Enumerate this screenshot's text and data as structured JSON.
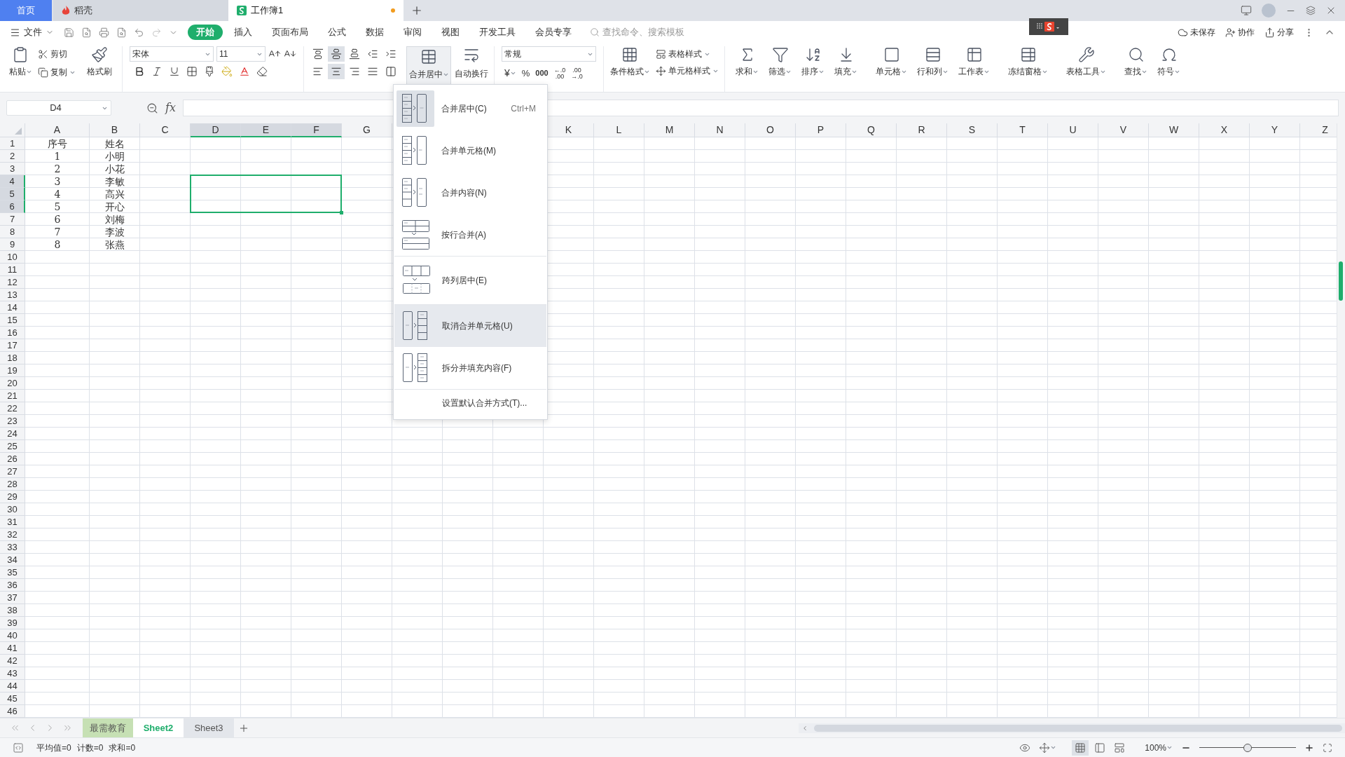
{
  "tabs": [
    {
      "kind": "home",
      "label": "首页",
      "selected": false,
      "modified": false
    },
    {
      "kind": "docer",
      "label": "稻壳",
      "selected": false,
      "modified": false
    },
    {
      "kind": "sheet",
      "label": "工作簿1",
      "selected": true,
      "modified": true
    }
  ],
  "menu": {
    "file": "文件",
    "items": [
      {
        "label": "开始",
        "selected": true
      },
      {
        "label": "插入",
        "selected": false
      },
      {
        "label": "页面布局",
        "selected": false
      },
      {
        "label": "公式",
        "selected": false
      },
      {
        "label": "数据",
        "selected": false
      },
      {
        "label": "审阅",
        "selected": false
      },
      {
        "label": "视图",
        "selected": false
      },
      {
        "label": "开发工具",
        "selected": false
      },
      {
        "label": "会员专享",
        "selected": false
      }
    ],
    "search_placeholder": "查找命令、搜索模板",
    "actions": [
      {
        "kind": "cloud",
        "label": "未保存"
      },
      {
        "kind": "collab",
        "label": "协作"
      },
      {
        "kind": "share",
        "label": "分享"
      }
    ]
  },
  "ribbon": {
    "clipboard": {
      "paste": "粘贴",
      "cut": "剪切",
      "copy": "复制",
      "format_painter": "格式刷"
    },
    "font": {
      "name": "宋体",
      "size": "11"
    },
    "align_buttons": [
      {
        "kind": "top",
        "selected": false
      },
      {
        "kind": "middle",
        "selected": true
      },
      {
        "kind": "bottom",
        "selected": false
      },
      {
        "kind": "indent_less",
        "selected": false
      },
      {
        "kind": "indent_more",
        "selected": false
      },
      {
        "kind": "left",
        "selected": false
      },
      {
        "kind": "center",
        "selected": true
      },
      {
        "kind": "right",
        "selected": false
      },
      {
        "kind": "justify",
        "selected": false
      },
      {
        "kind": "distributed",
        "selected": false
      }
    ],
    "merge": {
      "label": "合并居中",
      "expanded": true
    },
    "wrap": "自动换行",
    "number": {
      "format": "常规",
      "currency": "¥",
      "percent": "%",
      "thousands": "000",
      "increase_decimal": [
        "←.0",
        ".00"
      ],
      "decrease_decimal": [
        ".00",
        "→.0"
      ]
    },
    "styles": {
      "conditional": "条件格式",
      "table_style": "表格样式",
      "cell_style": "单元格样式"
    },
    "tools": [
      {
        "kind": "sum",
        "label": "求和"
      },
      {
        "kind": "filter",
        "label": "筛选"
      },
      {
        "kind": "sort",
        "label": "排序"
      },
      {
        "kind": "fill",
        "label": "填充"
      },
      {
        "kind": "cell",
        "label": "单元格"
      },
      {
        "kind": "rowcol",
        "label": "行和列"
      },
      {
        "kind": "worksheet",
        "label": "工作表"
      },
      {
        "kind": "freeze",
        "label": "冻结窗格"
      },
      {
        "kind": "tabletools",
        "label": "表格工具"
      },
      {
        "kind": "find",
        "label": "查找"
      },
      {
        "kind": "symbol",
        "label": "符号"
      }
    ]
  },
  "formula_bar": {
    "name_box": "D4",
    "fx": "fx"
  },
  "columns": [
    {
      "label": "A",
      "selected": false
    },
    {
      "label": "B",
      "selected": false
    },
    {
      "label": "C",
      "selected": false
    },
    {
      "label": "D",
      "selected": true
    },
    {
      "label": "E",
      "selected": true
    },
    {
      "label": "F",
      "selected": true
    },
    {
      "label": "G",
      "selected": false
    },
    {},
    {},
    {},
    {
      "label": "K",
      "selected": false
    },
    {
      "label": "L",
      "selected": false
    },
    {
      "label": "M",
      "selected": false
    },
    {
      "label": "N",
      "selected": false
    },
    {
      "label": "O",
      "selected": false
    },
    {
      "label": "P",
      "selected": false
    },
    {
      "label": "Q",
      "selected": false
    },
    {
      "label": "R",
      "selected": false
    },
    {
      "label": "S",
      "selected": false
    },
    {
      "label": "T",
      "selected": false
    },
    {
      "label": "U",
      "selected": false
    },
    {
      "label": "V",
      "selected": false
    },
    {
      "label": "W",
      "selected": false
    },
    {
      "label": "X",
      "selected": false
    },
    {
      "label": "Y",
      "selected": false
    },
    {
      "label": "Z",
      "selected": false
    }
  ],
  "rows": [
    {
      "label": "1",
      "selected": false,
      "cells": [
        "序号",
        "姓名"
      ]
    },
    {
      "label": "2",
      "selected": false,
      "cells": [
        "1",
        "小明"
      ]
    },
    {
      "label": "3",
      "selected": false,
      "cells": [
        "2",
        "小花"
      ]
    },
    {
      "label": "4",
      "selected": true,
      "cells": [
        "3",
        "李敏"
      ]
    },
    {
      "label": "5",
      "selected": true,
      "cells": [
        "4",
        "高兴"
      ]
    },
    {
      "label": "6",
      "selected": true,
      "cells": [
        "5",
        "开心"
      ]
    },
    {
      "label": "7",
      "selected": false,
      "cells": [
        "6",
        "刘梅"
      ]
    },
    {
      "label": "8",
      "selected": false,
      "cells": [
        "7",
        "李波"
      ]
    },
    {
      "label": "9",
      "selected": false,
      "cells": [
        "8",
        "张燕"
      ]
    },
    {
      "label": "10",
      "selected": false
    },
    {
      "label": "11",
      "selected": false
    },
    {
      "label": "12",
      "selected": false
    },
    {
      "label": "13",
      "selected": false
    },
    {
      "label": "14",
      "selected": false
    },
    {
      "label": "15",
      "selected": false
    },
    {
      "label": "16",
      "selected": false
    },
    {
      "label": "17",
      "selected": false
    },
    {
      "label": "18",
      "selected": false
    },
    {
      "label": "19",
      "selected": false
    },
    {
      "label": "20",
      "selected": false
    },
    {
      "label": "21",
      "selected": false
    },
    {
      "label": "22",
      "selected": false
    },
    {
      "label": "23",
      "selected": false
    },
    {
      "label": "24",
      "selected": false
    },
    {
      "label": "25",
      "selected": false
    },
    {
      "label": "26",
      "selected": false
    },
    {
      "label": "27",
      "selected": false
    },
    {
      "label": "28",
      "selected": false
    },
    {
      "label": "29",
      "selected": false
    },
    {
      "label": "30",
      "selected": false
    },
    {
      "label": "31",
      "selected": false
    },
    {
      "label": "32",
      "selected": false
    },
    {
      "label": "33",
      "selected": false
    },
    {
      "label": "34",
      "selected": false
    },
    {
      "label": "35",
      "selected": false
    },
    {
      "label": "36",
      "selected": false
    },
    {
      "label": "37",
      "selected": false
    },
    {
      "label": "38",
      "selected": false
    },
    {
      "label": "39",
      "selected": false
    },
    {
      "label": "40",
      "selected": false
    },
    {
      "label": "41",
      "selected": false
    },
    {
      "label": "42",
      "selected": false
    },
    {
      "label": "43",
      "selected": false
    },
    {
      "label": "44",
      "selected": false
    },
    {
      "label": "45",
      "selected": false
    },
    {
      "label": "46",
      "selected": false
    }
  ],
  "merge_menu": {
    "groups": [
      [
        {
          "kind": "merge_center",
          "label": "合并居中(C)",
          "shortcut": "Ctrl+M",
          "current": true,
          "highlighted": false
        },
        {
          "kind": "merge_cells",
          "label": "合并单元格(M)",
          "current": false,
          "highlighted": false
        },
        {
          "kind": "merge_content",
          "label": "合并内容(N)",
          "current": false,
          "highlighted": false
        },
        {
          "kind": "merge_rows",
          "label": "按行合并(A)",
          "current": false,
          "highlighted": false
        }
      ],
      [
        {
          "kind": "center_across",
          "label": "跨列居中(E)",
          "current": false,
          "highlighted": false
        }
      ],
      [
        {
          "kind": "unmerge",
          "label": "取消合并单元格(U)",
          "current": false,
          "highlighted": true
        },
        {
          "kind": "split_fill",
          "label": "拆分并填充内容(F)",
          "current": false,
          "highlighted": false
        }
      ],
      [
        {
          "kind": "setting",
          "label": "设置默认合并方式(T)...",
          "current": false,
          "highlighted": false
        }
      ]
    ]
  },
  "sheet_tabs": [
    {
      "label": "最需教育",
      "selected": false,
      "color": "#c6e0b4"
    },
    {
      "label": "Sheet2",
      "selected": true
    },
    {
      "label": "Sheet3",
      "selected": false
    }
  ],
  "status_bar": {
    "stats": [
      "平均值=0",
      "计数=0",
      "求和=0"
    ],
    "views": [
      {
        "kind": "normal",
        "selected": true
      },
      {
        "kind": "page",
        "selected": false
      },
      {
        "kind": "break",
        "selected": false
      }
    ],
    "zoom": "100%",
    "zoom_slider": {
      "level": 0.5
    }
  }
}
